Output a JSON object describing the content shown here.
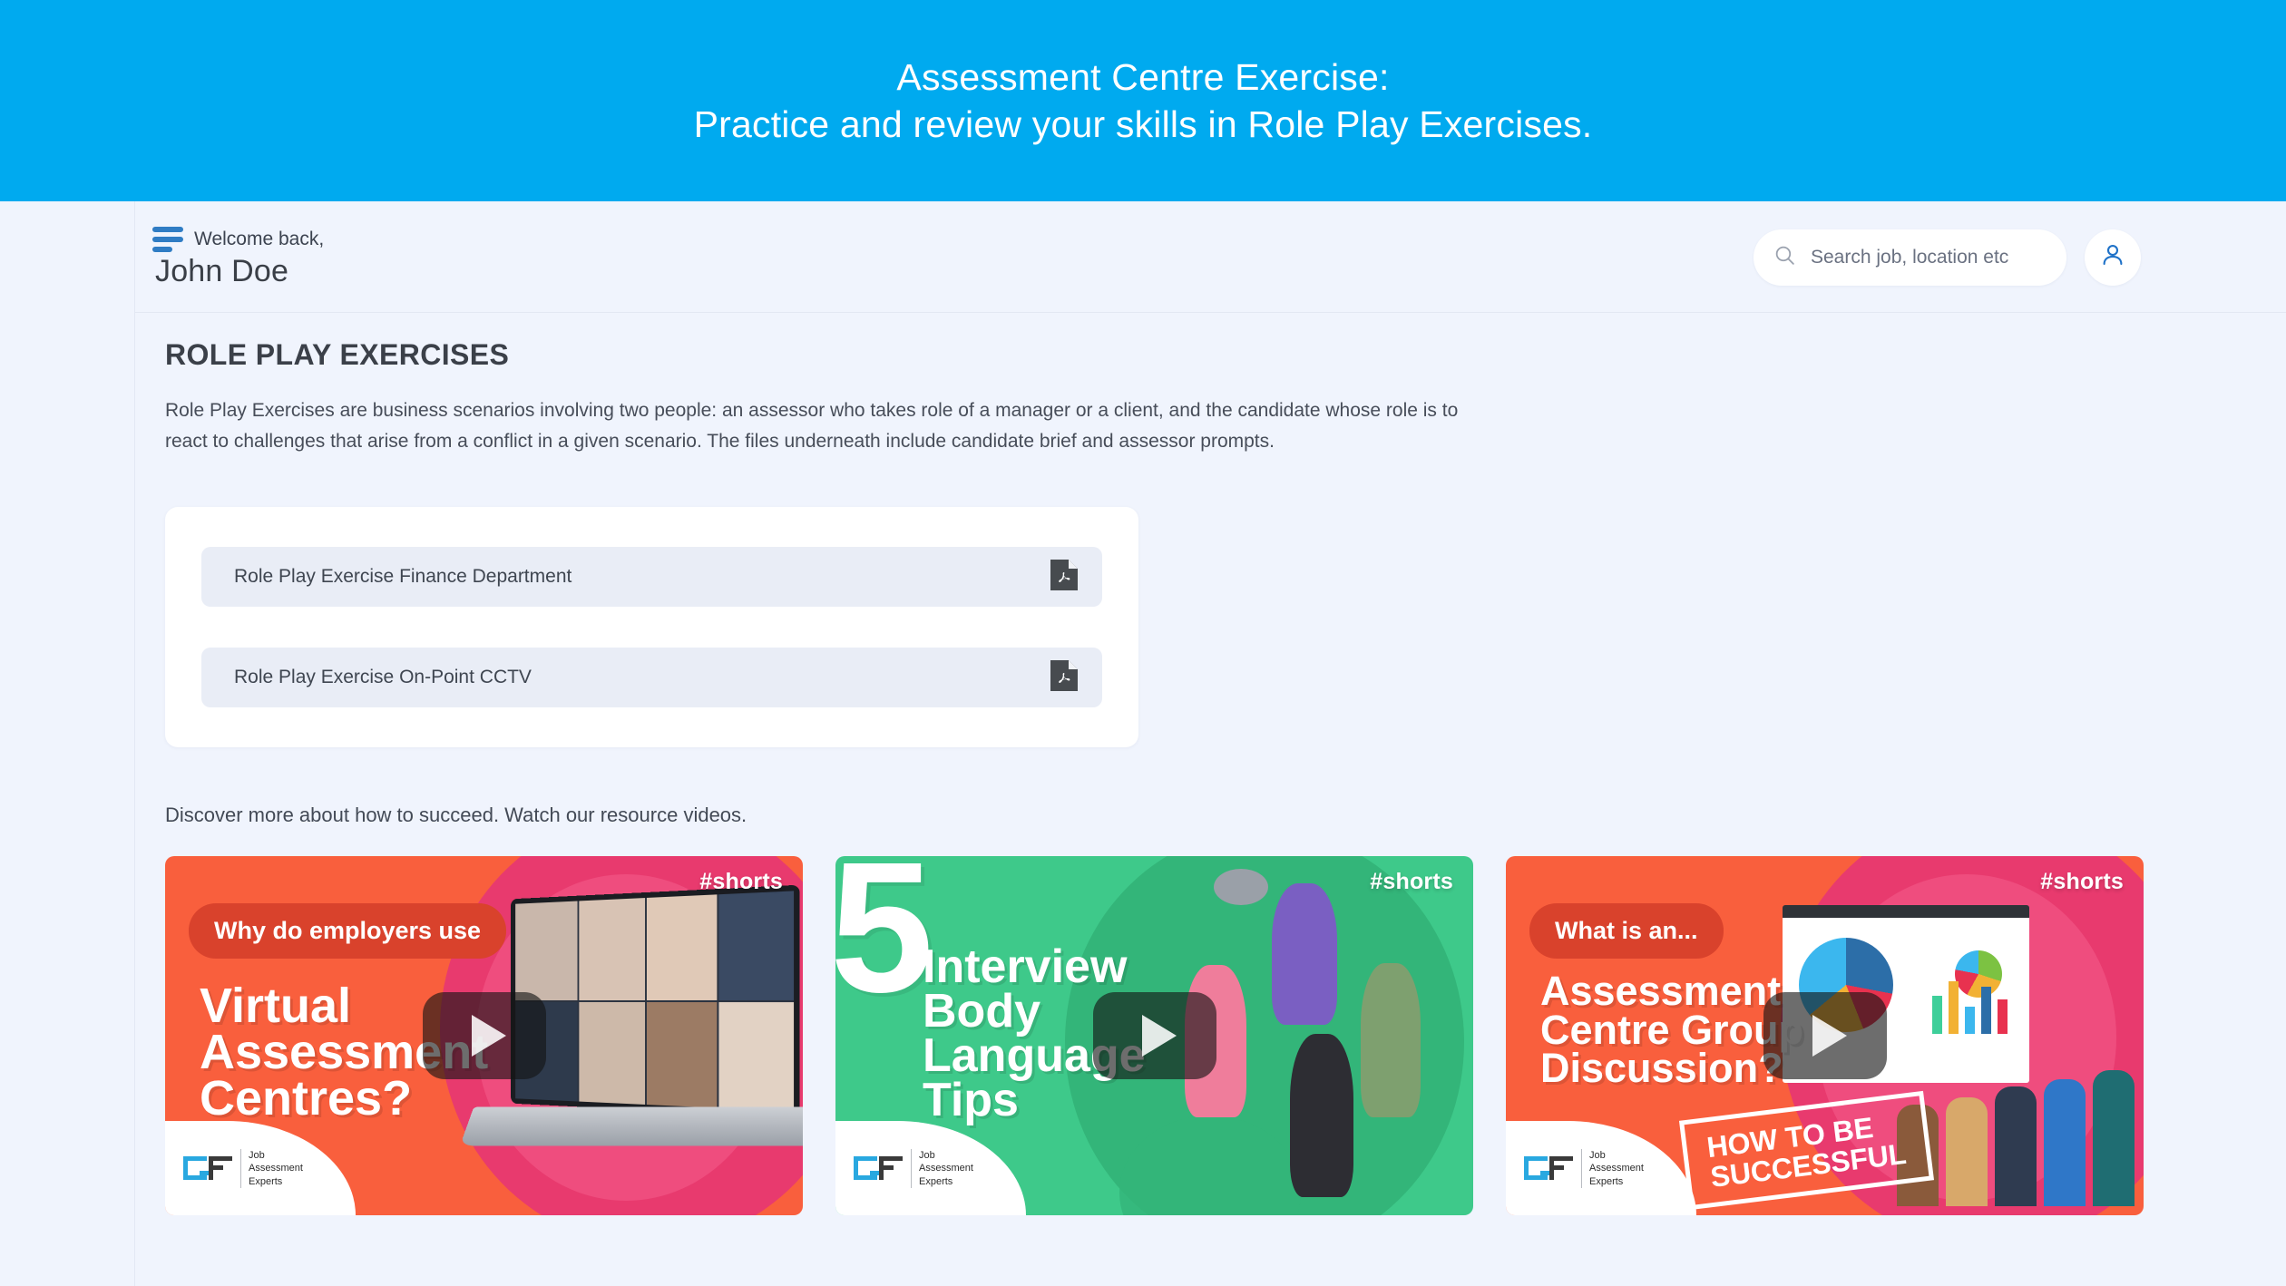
{
  "banner": {
    "line1": "Assessment Centre Exercise:",
    "line2": "Practice and review your skills in Role Play Exercises.",
    "bg_color": "#00aaef"
  },
  "header": {
    "menu_icon": "hamburger-icon",
    "welcome_label": "Welcome back,",
    "user_name": "John Doe",
    "search": {
      "icon": "search-icon",
      "placeholder": "Search job, location etc",
      "value": ""
    },
    "account_icon": "user-avatar-icon",
    "accent_color": "#2f7cc4"
  },
  "main": {
    "page_title": "ROLE PLAY EXERCISES",
    "intro": "Role Play Exercises are business scenarios involving two people: an assessor who takes role of a manager or a client, and the candidate whose role is to react to challenges that arise from a conflict in a given scenario. The files underneath include candidate brief and assessor prompts.",
    "files": [
      {
        "name": "Role Play Exercise Finance Department",
        "icon": "pdf-file-icon"
      },
      {
        "name": "Role Play Exercise On-Point CCTV",
        "icon": "pdf-file-icon"
      }
    ],
    "discover_text": "Discover more about how to succeed. Watch our resource videos.",
    "videos": [
      {
        "shorts_tag": "#shorts",
        "pill": "Why do employers use",
        "title": "Virtual\nAssessment\nCentres?",
        "stamp": "",
        "bg_color": "#f95f3d",
        "play_icon": "play-icon",
        "logo": "Job\nAssessment\nExperts"
      },
      {
        "shorts_tag": "#shorts",
        "pill": "",
        "number": "5",
        "title": "Interview\nBody\nLanguage\nTips",
        "stamp": "",
        "bg_color": "#3ec98a",
        "play_icon": "play-icon",
        "logo": "Job\nAssessment\nExperts"
      },
      {
        "shorts_tag": "#shorts",
        "pill": "What is an...",
        "title": "Assessment\nCentre Group\nDiscussion?",
        "stamp": "HOW TO BE\nSUCCESSFUL",
        "bg_color": "#f95f3d",
        "play_icon": "play-icon",
        "logo": "Job\nAssessment\nExperts"
      }
    ]
  }
}
